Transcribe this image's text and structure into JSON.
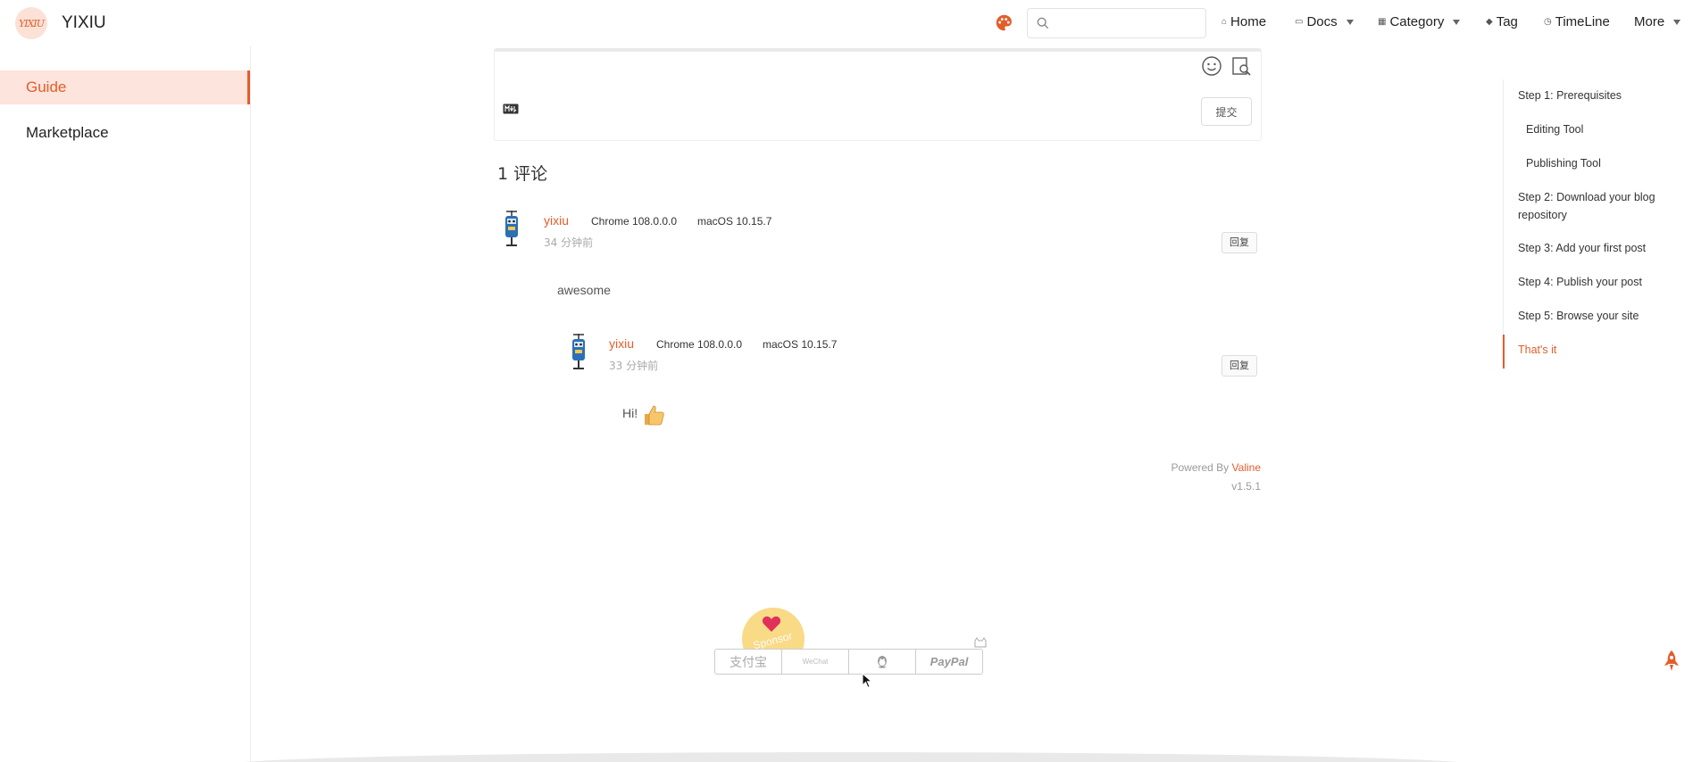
{
  "navbar": {
    "logo_text": "YIXIU",
    "title": "YIXIU",
    "search": {
      "value": "",
      "placeholder": ""
    },
    "links": {
      "home": "Home",
      "docs": "Docs",
      "category": "Category",
      "tag": "Tag",
      "timeline": "TimeLine",
      "more": "More"
    }
  },
  "sidebar": {
    "items": [
      {
        "label": "Guide",
        "active": true
      },
      {
        "label": "Marketplace",
        "active": false
      }
    ]
  },
  "comment_form": {
    "submit_label": "提交"
  },
  "comments": {
    "count_title": "1 评论",
    "list": [
      {
        "nick": "yixiu",
        "browser": "Chrome 108.0.0.0",
        "os": "macOS 10.15.7",
        "time": "34 分钟前",
        "reply_label": "回复",
        "content": "awesome",
        "replies": [
          {
            "nick": "yixiu",
            "browser": "Chrome 108.0.0.0",
            "os": "macOS 10.15.7",
            "time": "33 分钟前",
            "reply_label": "回复",
            "content": "Hi!"
          }
        ]
      }
    ],
    "powered_prefix": "Powered By",
    "powered_name": "Valine",
    "version": "v1.5.1"
  },
  "sponsor": {
    "badge_label": "Sponsor",
    "methods": [
      "支付宝",
      "WeChat",
      "QQ",
      "PayPal"
    ]
  },
  "toc": {
    "items": [
      {
        "label": "Step 1: Prerequisites",
        "level": 1,
        "active": false
      },
      {
        "label": "Editing Tool",
        "level": 2,
        "active": false
      },
      {
        "label": "Publishing Tool",
        "level": 2,
        "active": false
      },
      {
        "label": "Step 2: Download your blog repository",
        "level": 1,
        "active": false
      },
      {
        "label": "Step 3: Add your first post",
        "level": 1,
        "active": false
      },
      {
        "label": "Step 4: Publish your post",
        "level": 1,
        "active": false
      },
      {
        "label": "Step 5: Browse your site",
        "level": 1,
        "active": false
      },
      {
        "label": "That's it",
        "level": 1,
        "active": true
      }
    ]
  },
  "icons": {
    "logo": "logo-icon",
    "theme": "palette-icon",
    "search": "search-icon",
    "home": "home-icon",
    "docs": "book-icon",
    "category": "grid-icon",
    "tag": "tag-icon",
    "timeline": "clock-icon",
    "emoji": "emoji-icon",
    "preview": "preview-icon",
    "markdown": "markdown-icon",
    "back_to_top": "rocket-icon"
  },
  "colors": {
    "accent": "#e35d2b",
    "accent_bg": "#fde4dc",
    "muted": "#aaaaaa"
  }
}
